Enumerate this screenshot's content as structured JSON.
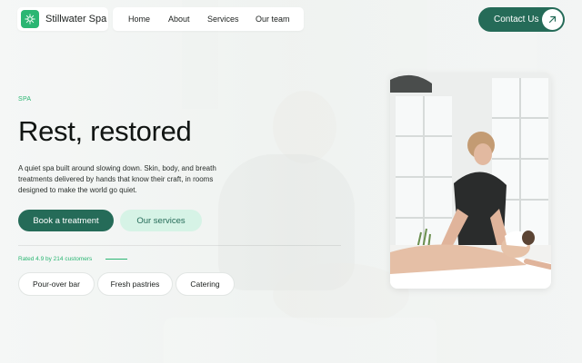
{
  "brand": {
    "name": "Stillwater Spa",
    "logo_icon": "sparkle-icon",
    "accent": "#2bb673"
  },
  "nav": {
    "items": [
      {
        "label": "Home"
      },
      {
        "label": "About"
      },
      {
        "label": "Services"
      },
      {
        "label": "Our team"
      }
    ]
  },
  "contact": {
    "label": "Contact Us",
    "icon": "arrow-up-right-icon",
    "color": "#256b58"
  },
  "hero": {
    "eyebrow": "SPA",
    "headline": "Rest, restored",
    "description": "A quiet spa built around slowing down. Skin, body, and breath treatments delivered by hands that know their craft, in rooms designed to make the world go quiet.",
    "primary_cta": "Book a treatment",
    "secondary_cta": "Our services",
    "rating": "Rated 4.9 by 214 customers",
    "chips": [
      {
        "label": "Pour-over bar"
      },
      {
        "label": "Fresh pastries"
      },
      {
        "label": "Catering"
      }
    ]
  },
  "colors": {
    "primary": "#256b58",
    "accent": "#2bb673",
    "secondary_bg": "#d6f3e6"
  }
}
